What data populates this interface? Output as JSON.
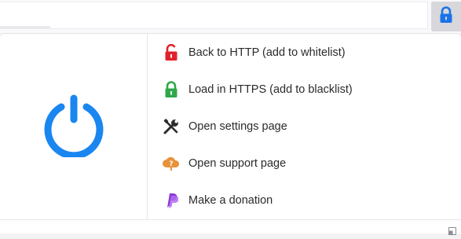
{
  "toolbar": {
    "extension_icon": "lock-icon",
    "accent_color": "#1a73e8"
  },
  "panel": {
    "toggle_icon": "power-icon",
    "toggle_color": "#1a86f0",
    "menu": [
      {
        "label": "Back to HTTP (add to whitelist)",
        "icon": "unlocked-padlock-icon",
        "color": "#e0222c"
      },
      {
        "label": "Load in HTTPS (add to blacklist)",
        "icon": "locked-padlock-icon",
        "color": "#2ea84a"
      },
      {
        "label": "Open settings page",
        "icon": "tools-icon",
        "color": "#2b2b2b"
      },
      {
        "label": "Open support page",
        "icon": "help-cloud-icon",
        "color": "#e8923a"
      },
      {
        "label": "Make a donation",
        "icon": "paypal-icon",
        "color": "#8a3ad6"
      }
    ]
  }
}
